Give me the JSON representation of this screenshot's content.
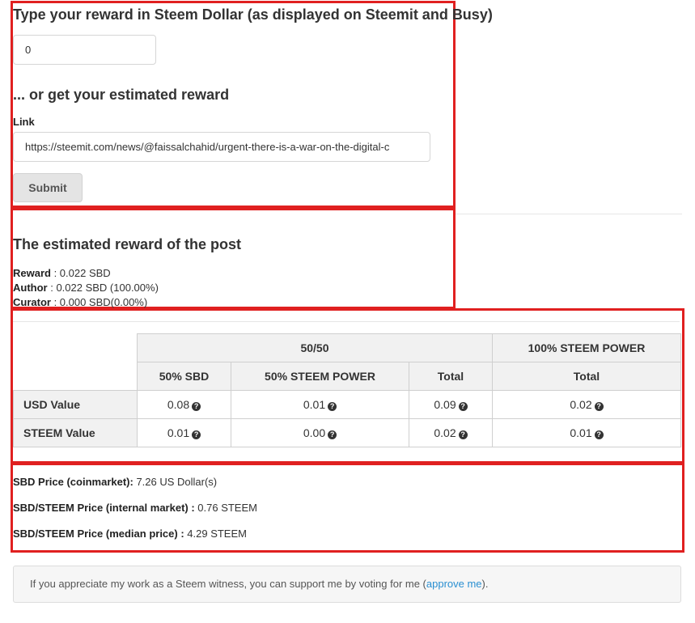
{
  "section_input": {
    "title": "Type your reward in Steem Dollar (as displayed on Steemit and Busy)",
    "reward_value": "0",
    "alt_title": "... or get your estimated reward",
    "link_label": "Link",
    "link_value": "https://steemit.com/news/@faissalchahid/urgent-there-is-a-war-on-the-digital-c",
    "submit_label": "Submit"
  },
  "estimate": {
    "title": "The estimated reward of the post",
    "reward_label": "Reward",
    "reward_value": " : 0.022 SBD",
    "author_label": "Author",
    "author_value": " : 0.022 SBD (100.00%)",
    "curator_label": "Curator",
    "curator_value": " : 0.000 SBD(0.00%)"
  },
  "table": {
    "group1": "50/50",
    "group2": "100% STEEM POWER",
    "col1": "50% SBD",
    "col2": "50% STEEM POWER",
    "col3": "Total",
    "col4": "Total",
    "rows": [
      {
        "label": "USD Value",
        "values": [
          "0.08",
          "0.01",
          "0.09",
          "0.02"
        ]
      },
      {
        "label": "STEEM Value",
        "values": [
          "0.01",
          "0.00",
          "0.02",
          "0.01"
        ]
      }
    ],
    "help_glyph": "?"
  },
  "prices": {
    "sbd_label": "SBD Price (coinmarket):",
    "sbd_value": " 7.26 US Dollar(s)",
    "internal_label": "SBD/STEEM Price (internal market) :",
    "internal_value": " 0.76 STEEM",
    "median_label": "SBD/STEEM Price (median price) :",
    "median_value": " 4.29 STEEM"
  },
  "notice": {
    "text_before": "If you appreciate my work as a Steem witness, you can support me by voting for me (",
    "link_text": "approve me",
    "text_after": ")."
  },
  "colors": {
    "highlight_border": "#e02020",
    "link": "#2a8fd1",
    "header_bg": "#f1f1f1"
  }
}
